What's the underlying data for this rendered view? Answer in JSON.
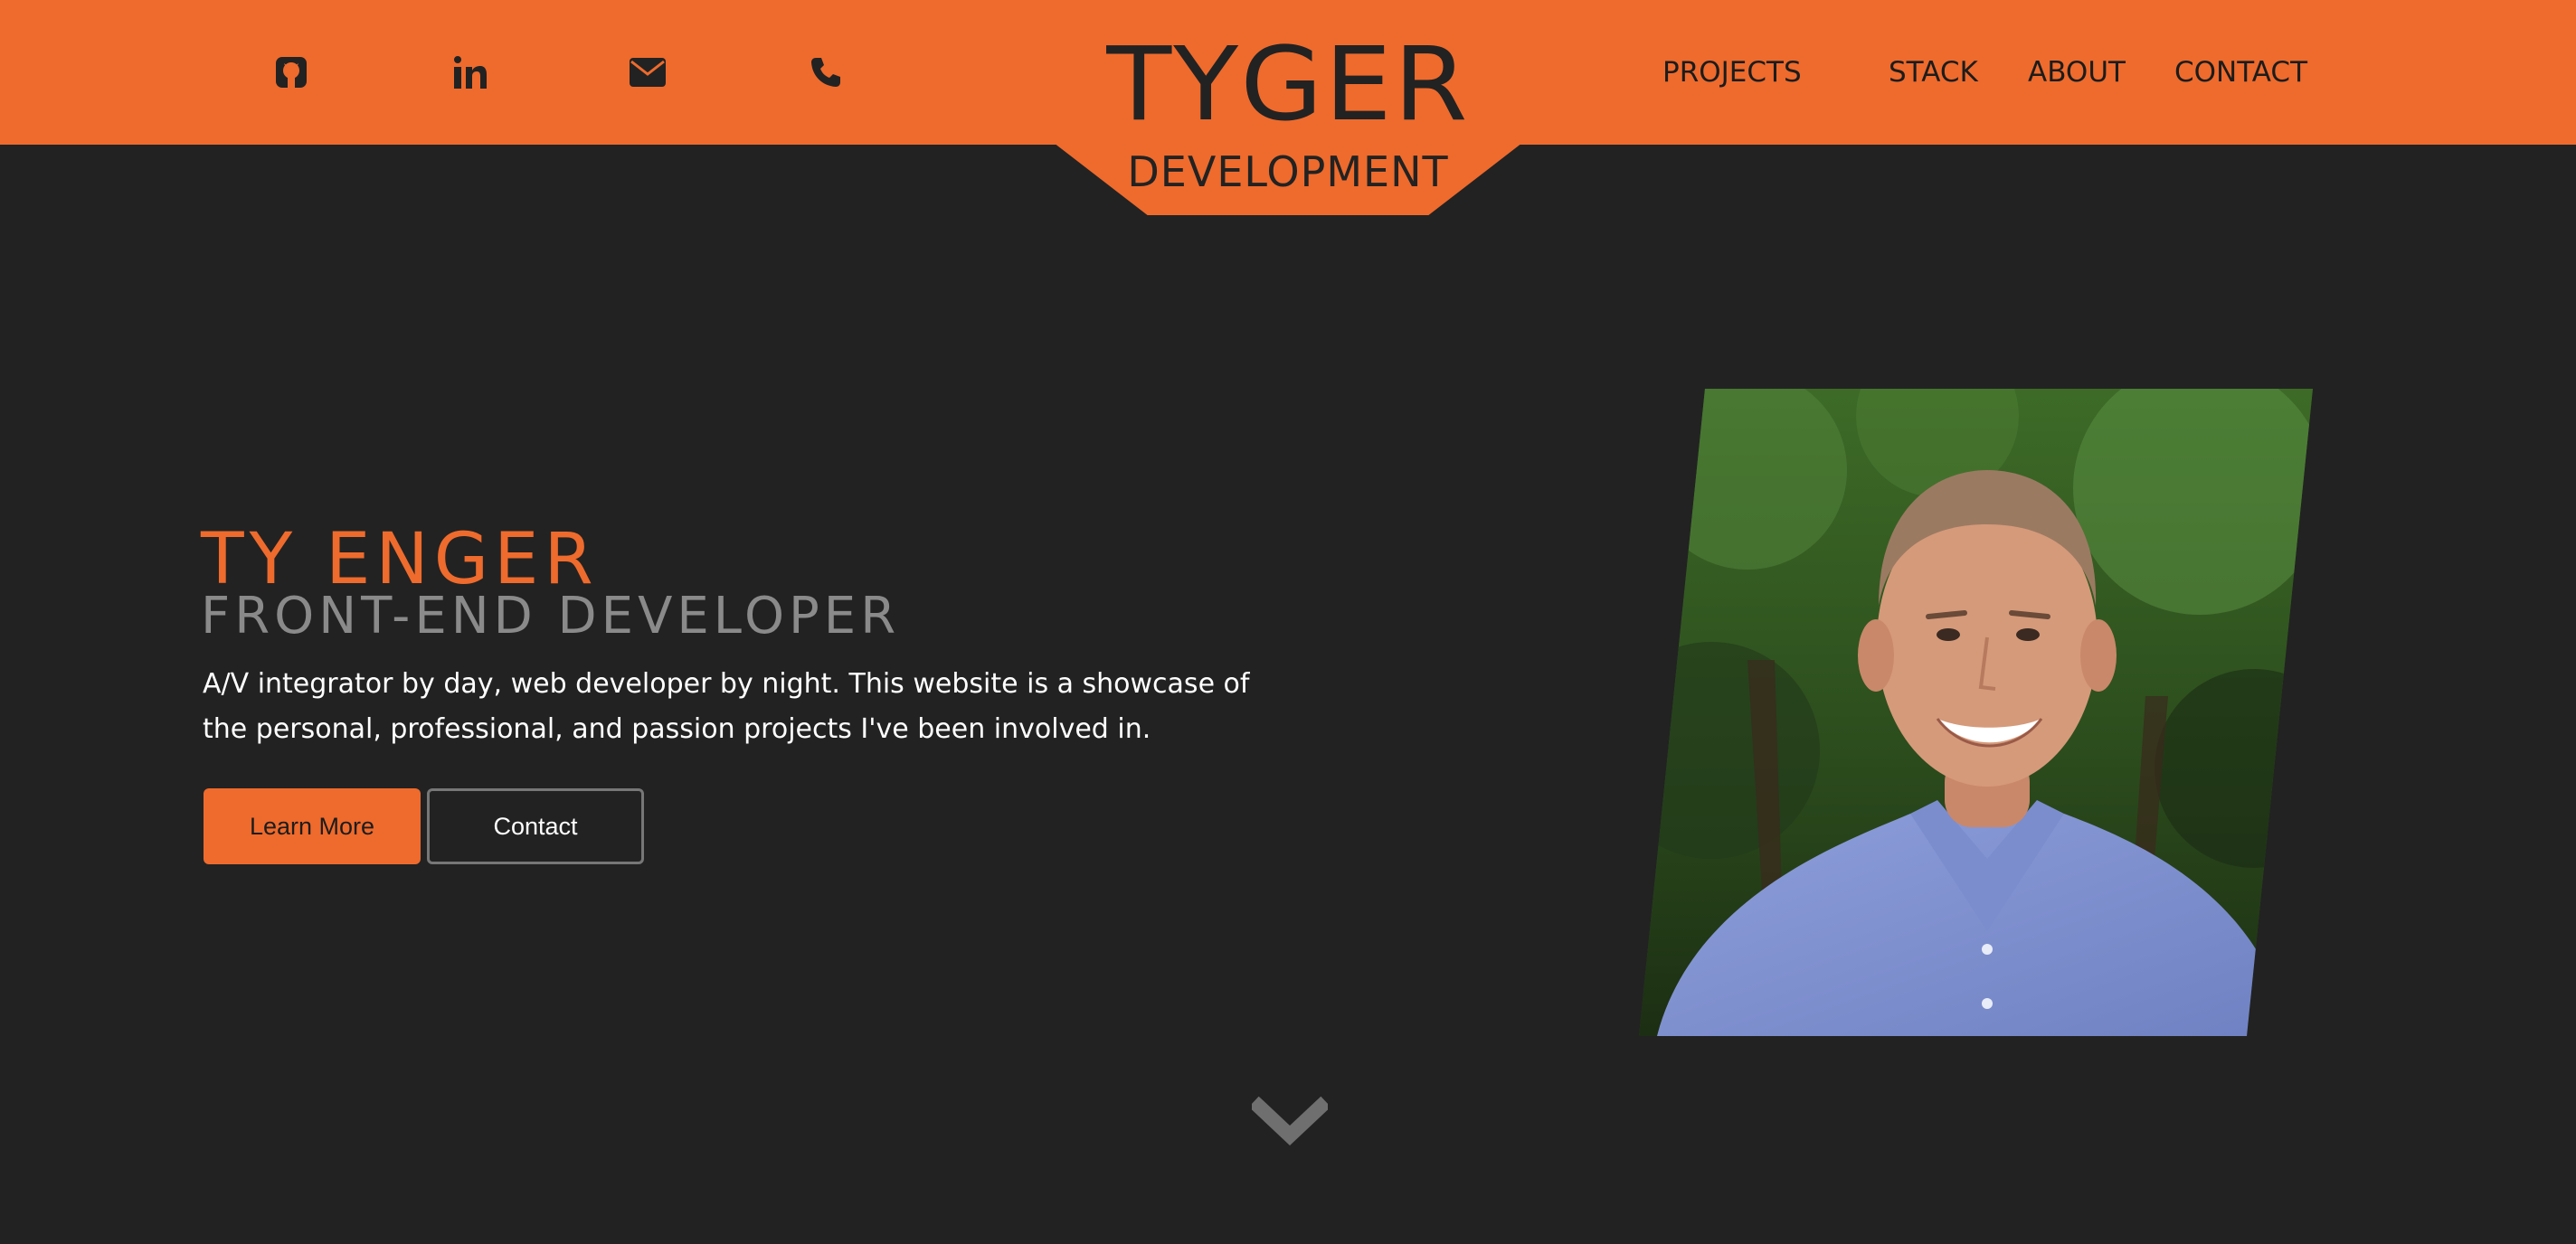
{
  "header": {
    "social": [
      {
        "icon": "github-icon"
      },
      {
        "icon": "linkedin-icon"
      },
      {
        "icon": "envelope-icon"
      },
      {
        "icon": "phone-icon"
      }
    ],
    "logo": {
      "main": "TYGER",
      "sub": "DEVELOPMENT"
    },
    "nav": [
      {
        "label": "PROJECTS"
      },
      {
        "label": "STACK"
      },
      {
        "label": "ABOUT"
      },
      {
        "label": "CONTACT"
      }
    ]
  },
  "hero": {
    "name": "TY ENGER",
    "role": "FRONT-END DEVELOPER",
    "description": "A/V integrator by day, web developer by night. This website is a showcase of the personal, professional, and passion projects I've been involved in.",
    "buttons": {
      "primary": "Learn More",
      "secondary": "Contact"
    },
    "scroll_icon": "chevron-down-icon"
  },
  "colors": {
    "accent": "#ee6b2d",
    "background": "#222222",
    "muted_text": "#8a8a8a",
    "text": "#ffffff"
  }
}
